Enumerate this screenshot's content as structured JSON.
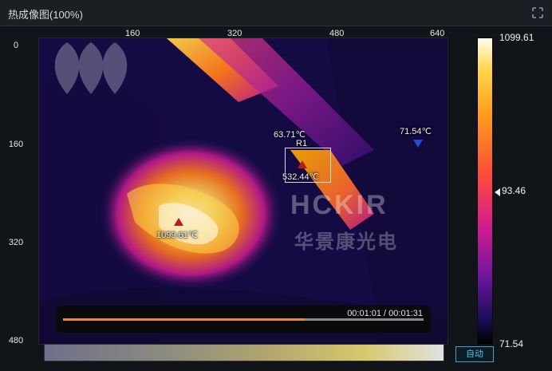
{
  "window": {
    "title": "热成像图(100%)",
    "expand_icon": "expand-icon"
  },
  "axes": {
    "x_ticks": [
      "160",
      "320",
      "480",
      "640"
    ],
    "y_ticks": [
      "0",
      "160",
      "320",
      "480"
    ]
  },
  "thermal_image": {
    "watermark_brand": "HCKIR",
    "watermark_subtitle": "华景康光电",
    "colors": {
      "hot": "#ffffff",
      "warm": "#ffb000",
      "mid": "#ff4a3b",
      "magenta": "#c21a8e",
      "cold": "#1b0d56"
    },
    "annotations": {
      "roi_label": "R1",
      "roi_top_temp": "63.71℃",
      "roi_max_temp": "532.44℃",
      "max_temp_label": "1099.61℃",
      "min_temp_label": "71.54℃"
    }
  },
  "player": {
    "time_text": "00:01:01 / 00:01:31",
    "progress": 0.67
  },
  "controls": {
    "auto_label": "自动"
  },
  "colorbar": {
    "max": "1099.61",
    "min": "71.54",
    "current": "93.46"
  }
}
